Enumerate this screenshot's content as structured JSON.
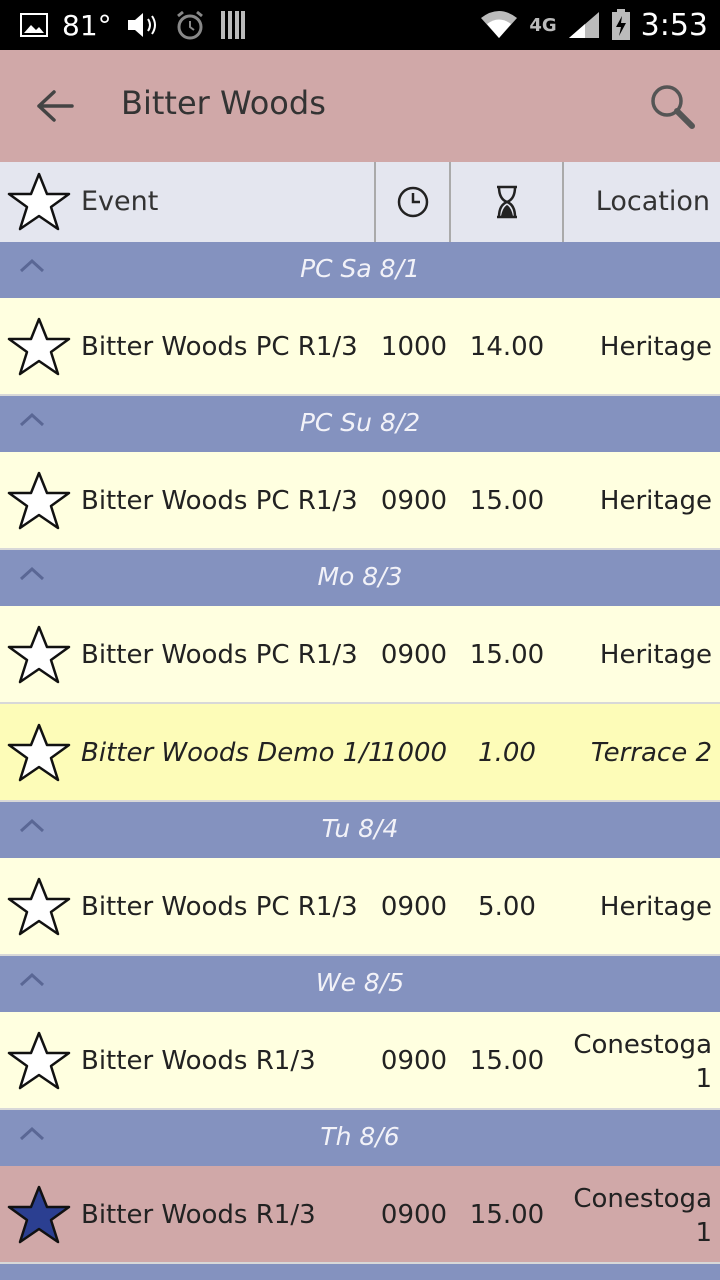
{
  "status_bar": {
    "temperature": "81°",
    "network": "4G",
    "time": "3:53"
  },
  "app_bar": {
    "title": "Bitter Woods",
    "back_icon": "arrow-left-icon",
    "search_icon": "search-icon"
  },
  "columns": {
    "event": "Event",
    "time_icon": "clock-icon",
    "duration_icon": "hourglass-icon",
    "location": "Location"
  },
  "colors": {
    "app_bar": "#d0a8a8",
    "group_header": "#8492bf",
    "row_bg": "#ffffe0",
    "row_alt_bg": "#fdfcb8",
    "selected_row": "#d0a8a8",
    "star_filled": "#2b3f91"
  },
  "groups": [
    {
      "title": "PC Sa 8/1",
      "rows": [
        {
          "event": "Bitter Woods PC R1/3",
          "time": "1000",
          "duration": "14.00",
          "location": "Heritage",
          "location2": ""
        }
      ]
    },
    {
      "title": "PC Su 8/2",
      "rows": [
        {
          "event": "Bitter Woods PC R1/3",
          "time": "0900",
          "duration": "15.00",
          "location": "Heritage",
          "location2": ""
        }
      ]
    },
    {
      "title": "Mo 8/3",
      "rows": [
        {
          "event": "Bitter Woods PC R1/3",
          "time": "0900",
          "duration": "15.00",
          "location": "Heritage",
          "location2": ""
        },
        {
          "event": "Bitter Woods Demo 1/1",
          "time": "1000",
          "duration": "1.00",
          "location": "Terrace 2",
          "location2": ""
        }
      ]
    },
    {
      "title": "Tu 8/4",
      "rows": [
        {
          "event": "Bitter Woods PC R1/3",
          "time": "0900",
          "duration": "5.00",
          "location": "Heritage",
          "location2": ""
        }
      ]
    },
    {
      "title": "We 8/5",
      "rows": [
        {
          "event": "Bitter Woods R1/3",
          "time": "0900",
          "duration": "15.00",
          "location": "Conestoga",
          "location2": "1"
        }
      ]
    },
    {
      "title": "Th 8/6",
      "rows": [
        {
          "event": "Bitter Woods R1/3",
          "time": "0900",
          "duration": "15.00",
          "location": "Conestoga",
          "location2": "1"
        }
      ]
    }
  ]
}
